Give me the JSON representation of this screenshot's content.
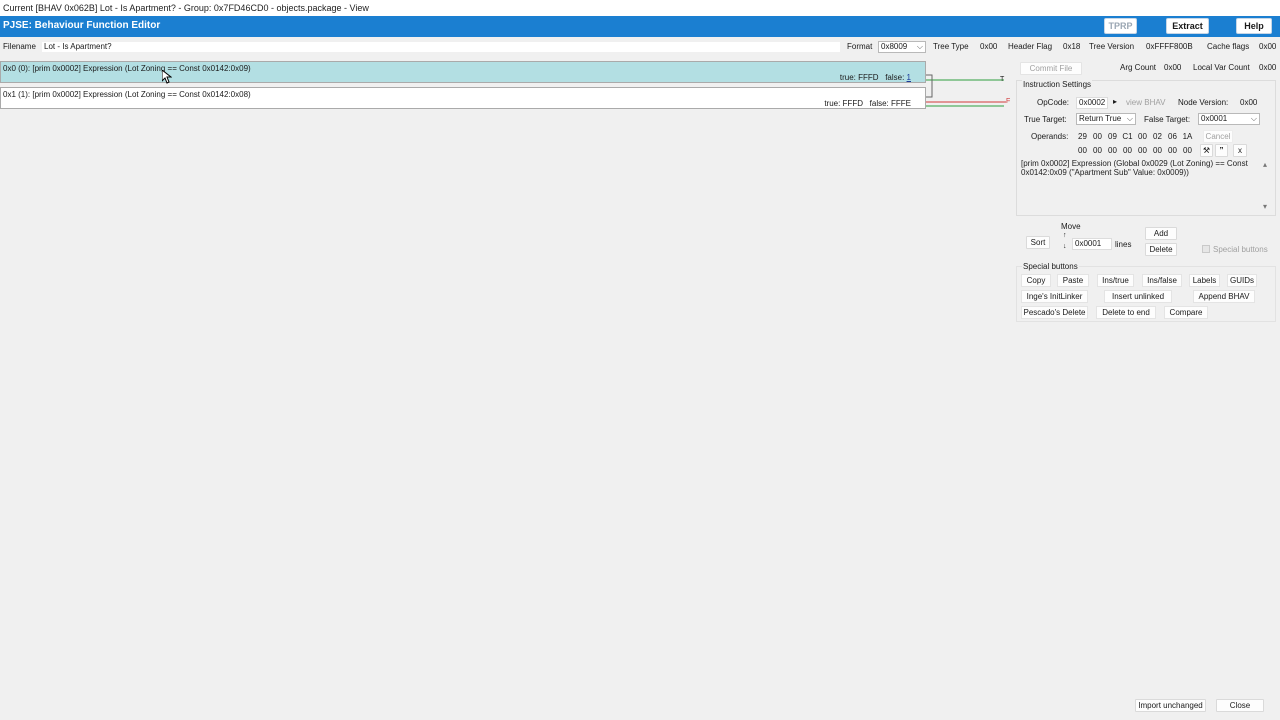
{
  "window": {
    "title": "Current [BHAV 0x062B] Lot - Is Apartment? - Group: 0x7FD46CD0 - objects.package - View"
  },
  "header": {
    "title": "PJSE: Behaviour Function Editor",
    "buttons": {
      "tprp": "TPRP",
      "extract": "Extract",
      "help": "Help"
    },
    "accent": "#1b7fd1"
  },
  "file": {
    "filename_label": "Filename",
    "filename_value": "Lot - Is Apartment?",
    "format_label": "Format",
    "format_value": "0x8009",
    "tree_type_label": "Tree Type",
    "tree_type_value": "0x00",
    "header_flag_label": "Header Flag",
    "header_flag_value": "0x18",
    "tree_version_label": "Tree Version",
    "tree_version_value": "0xFFFF800B",
    "cache_flags_label": "Cache flags",
    "cache_flags_value": "0x00",
    "commit_label": "Commit File",
    "arg_count_label": "Arg Count",
    "arg_count_value": "0x00",
    "local_var_label": "Local Var Count",
    "local_var_value": "0x00"
  },
  "instructions": [
    {
      "text": "0x0 (0): [prim 0x0002] Expression (Lot Zoning == Const 0x0142:0x09)",
      "true_label": "true: FFFD",
      "false_label": "false: ",
      "false_value": "1",
      "selected": true,
      "bg": "#b3dfe3"
    },
    {
      "text": "0x1 (1): [prim 0x0002] Expression (Lot Zoning == Const 0x0142:0x08)",
      "true_label": "true: FFFD",
      "false_label": "false: ",
      "false_value": "FFFE",
      "selected": false,
      "bg": "#ffffff"
    }
  ],
  "settings": {
    "title": "Instruction Settings",
    "opcode_label": "OpCode:",
    "opcode_value": "0x0002",
    "view_bhav": "view BHAV",
    "node_version_label": "Node Version:",
    "node_version_value": "0x00",
    "true_target_label": "True Target:",
    "true_target_value": "Return True",
    "false_target_label": "False Target:",
    "false_target_value": "0x0001",
    "operands_label": "Operands:",
    "operands_row1": [
      "29",
      "00",
      "09",
      "C1",
      "00",
      "02",
      "06",
      "1A"
    ],
    "operands_row2": [
      "00",
      "00",
      "00",
      "00",
      "00",
      "00",
      "00",
      "00"
    ],
    "cancel_label": "Cancel",
    "quote_label": "”",
    "x_label": "x",
    "description": "[prim 0x0002] Expression (Global 0x0029 (Lot Zoning) == Const 0x0142:0x09 (\"Apartment Sub\" Value: 0x0009))"
  },
  "move": {
    "title": "Move",
    "sort_label": "Sort",
    "lines_value": "0x0001",
    "lines_label": "lines",
    "add_label": "Add",
    "delete_label": "Delete",
    "special_checkbox_label": "Special buttons"
  },
  "special": {
    "title": "Special buttons",
    "row1": [
      "Copy",
      "Paste",
      "Ins/true",
      "Ins/false",
      "Labels",
      "GUIDs"
    ],
    "row2": [
      "Inge's InitLinker",
      "Insert unlinked",
      "Append BHAV"
    ],
    "row3": [
      "Pescado's Delete",
      "Delete to end",
      "Compare"
    ]
  },
  "footer": {
    "import_label": "Import unchanged",
    "close_label": "Close"
  }
}
